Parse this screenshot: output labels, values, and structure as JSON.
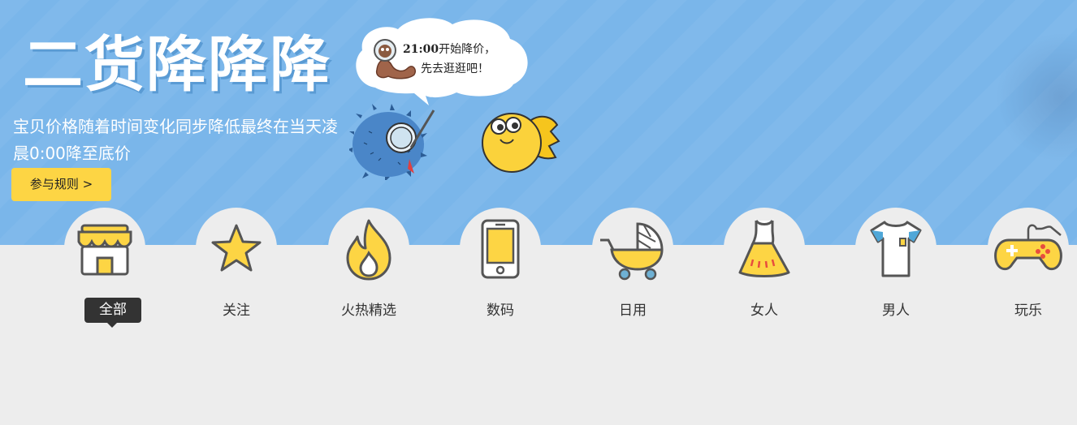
{
  "banner": {
    "title": "二货降降降",
    "subtitle": "宝贝价格随着时间变化同步降低最终在当天凌晨0:00降至底价",
    "rules_button": "参与规则 >",
    "background_color": "#7ab6ea",
    "button_color": "#fdd544"
  },
  "bubble": {
    "time": "21:00",
    "line1_text": "开始降价，",
    "line2_text": "先去逛逛吧！"
  },
  "categories": [
    {
      "label": "全部",
      "icon": "store-icon",
      "active": true
    },
    {
      "label": "关注",
      "icon": "star-icon",
      "active": false
    },
    {
      "label": "火热精选",
      "icon": "fire-icon",
      "active": false
    },
    {
      "label": "数码",
      "icon": "phone-icon",
      "active": false
    },
    {
      "label": "日用",
      "icon": "stroller-icon",
      "active": false
    },
    {
      "label": "女人",
      "icon": "dress-icon",
      "active": false
    },
    {
      "label": "男人",
      "icon": "tshirt-icon",
      "active": false
    },
    {
      "label": "玩乐",
      "icon": "gamepad-icon",
      "active": false
    }
  ]
}
